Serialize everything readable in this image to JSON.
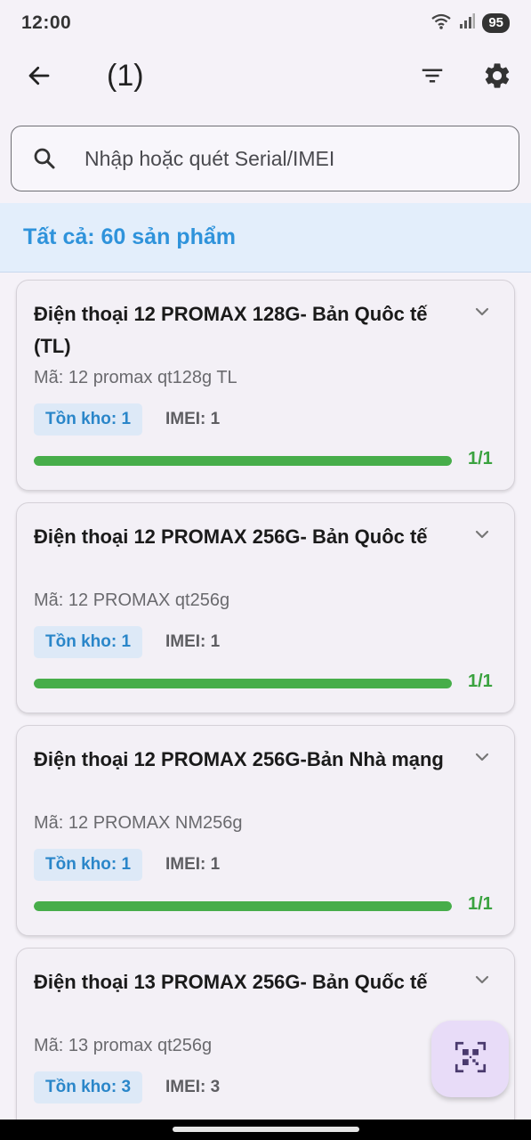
{
  "status_bar": {
    "time": "12:00",
    "battery": "95",
    "icons": [
      "wifi-icon",
      "signal-icon"
    ]
  },
  "app_bar": {
    "title": "(1)",
    "icons": [
      "back-arrow-icon",
      "filter-icon",
      "gear-icon"
    ]
  },
  "search": {
    "placeholder": "Nhập hoặc quét Serial/IMEI",
    "value": ""
  },
  "summary": {
    "text": "Tất cả: 60 sản phẩm"
  },
  "products": [
    {
      "title": "Điện thoại 12 PROMAX 128G- Bản Quôc tế (TL)",
      "code": "Mã: 12 promax qt128g TL",
      "stock": "Tồn kho: 1",
      "imei": "IMEI: 1",
      "progress_label": "1/1",
      "progress": 1.0
    },
    {
      "title": "Điện thoại 12 PROMAX 256G- Bản Quôc tế",
      "code": "Mã: 12 PROMAX qt256g",
      "stock": "Tồn kho: 1",
      "imei": "IMEI: 1",
      "progress_label": "1/1",
      "progress": 1.0
    },
    {
      "title": "Điện thoại 12 PROMAX 256G-Bản Nhà mạng",
      "code": "Mã: 12 PROMAX NM256g",
      "stock": "Tồn kho: 1",
      "imei": "IMEI: 1",
      "progress_label": "1/1",
      "progress": 1.0
    },
    {
      "title": "Điện thoại 13 PROMAX 256G- Bản Quốc tế",
      "code": "Mã: 13 promax qt256g",
      "stock": "Tồn kho: 3",
      "imei": "IMEI: 3"
    }
  ],
  "fab": {
    "icon": "qr-scan-icon"
  },
  "colors": {
    "accent": "#2f93db",
    "progress": "#47ad4a",
    "fab_bg": "#e8dcf8",
    "summary_bg": "#e3eefb"
  }
}
